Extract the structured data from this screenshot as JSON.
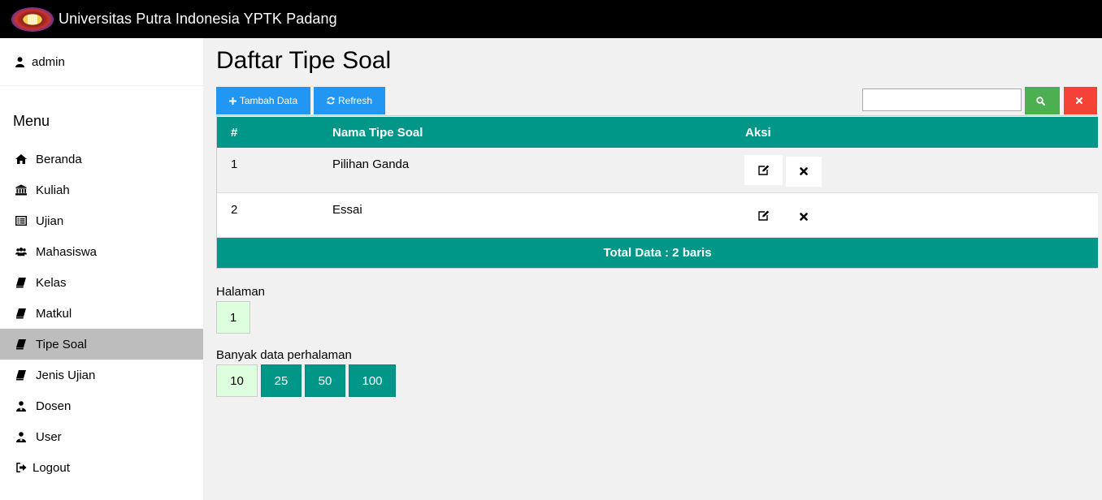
{
  "header": {
    "title": "Universitas Putra Indonesia YPTK Padang",
    "logo_icon": "university-logo-icon"
  },
  "sidebar": {
    "user": {
      "name": "admin",
      "icon": "user-icon"
    },
    "menu_title": "Menu",
    "items": [
      {
        "label": "Beranda",
        "icon": "home-icon"
      },
      {
        "label": "Kuliah",
        "icon": "bank-icon"
      },
      {
        "label": "Ujian",
        "icon": "list-alt-icon"
      },
      {
        "label": "Mahasiswa",
        "icon": "users-icon"
      },
      {
        "label": "Kelas",
        "icon": "book-icon"
      },
      {
        "label": "Matkul",
        "icon": "book-icon"
      },
      {
        "label": "Tipe Soal",
        "icon": "book-icon",
        "active": true
      },
      {
        "label": "Jenis Ujian",
        "icon": "book-icon"
      },
      {
        "label": "Dosen",
        "icon": "user-md-icon"
      },
      {
        "label": "User",
        "icon": "user-md-icon"
      },
      {
        "label": "Logout",
        "icon": "sign-out-icon"
      }
    ]
  },
  "main": {
    "title": "Daftar Tipe Soal",
    "toolbar": {
      "add_label": "Tambah Data",
      "refresh_label": "Refresh",
      "search_value": "",
      "search_button_icon": "search-icon",
      "clear_button_icon": "close-icon"
    },
    "table": {
      "headers": [
        "#",
        "Nama Tipe Soal",
        "Aksi"
      ],
      "rows": [
        {
          "no": "1",
          "name": "Pilihan Ganda"
        },
        {
          "no": "2",
          "name": "Essai"
        }
      ],
      "footer": "Total Data : 2 baris"
    },
    "pagination": {
      "label": "Halaman",
      "pages": [
        "1"
      ]
    },
    "per_page": {
      "label": "Banyak data perhalaman",
      "options": [
        "10",
        "25",
        "50",
        "100"
      ],
      "selected": "10"
    }
  },
  "colors": {
    "teal": "#009688",
    "blue": "#2196f3",
    "green": "#4caf50",
    "red": "#f44336",
    "selected_bg": "#ddffdd"
  }
}
